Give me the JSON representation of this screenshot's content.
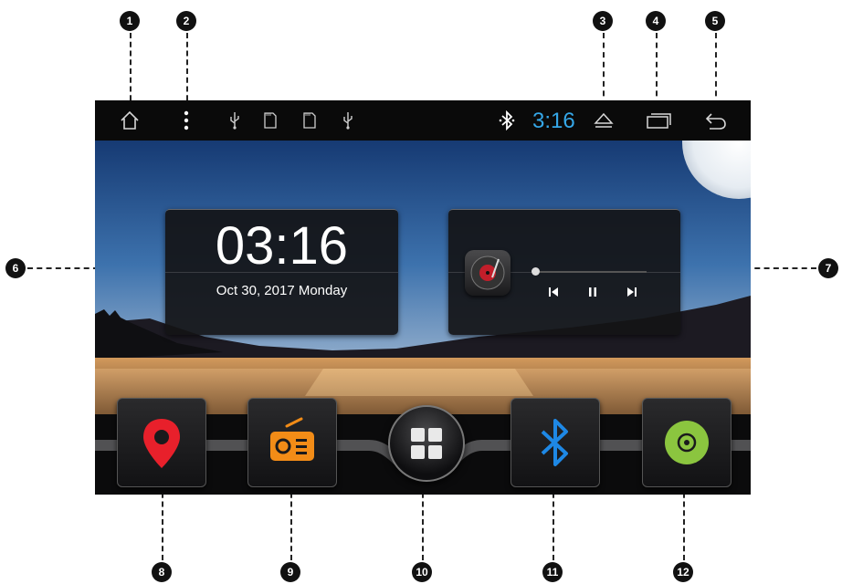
{
  "callouts": [
    "1",
    "2",
    "3",
    "4",
    "5",
    "6",
    "7",
    "8",
    "9",
    "10",
    "11",
    "12"
  ],
  "statusbar": {
    "time": "3:16",
    "icons": [
      "home-icon",
      "more-icon",
      "usb-icon",
      "sd-card-icon",
      "sd-card-icon",
      "usb-icon",
      "bluetooth-icon",
      "eject-icon",
      "recent-apps-icon",
      "back-icon"
    ],
    "time_color": "#35a7e8"
  },
  "clock_widget": {
    "time": "03:16",
    "date": "Oct 30, 2017  Monday"
  },
  "music_widget": {
    "progress": 0.0,
    "controls": [
      "previous-icon",
      "pause-icon",
      "next-icon"
    ]
  },
  "dock": {
    "items": [
      "navigation-icon",
      "radio-icon",
      "apps-grid-icon",
      "bluetooth-icon",
      "dvd-icon"
    ],
    "colors": {
      "navigation": "#e8202b",
      "radio": "#f28c17",
      "bluetooth": "#1e88e5",
      "dvd": "#8bc53f"
    }
  }
}
